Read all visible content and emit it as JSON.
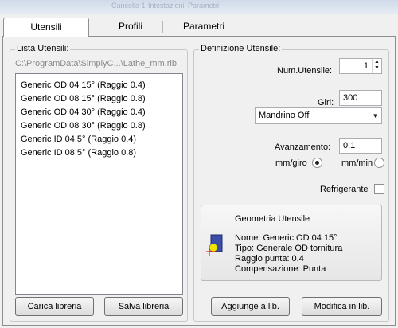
{
  "background_windows": [
    "Cancella 1",
    "Intestazioni",
    "Parametri"
  ],
  "tabs": [
    {
      "label": "Utensili",
      "selected": true
    },
    {
      "label": "Profili",
      "selected": false
    },
    {
      "label": "Parametri",
      "selected": false
    }
  ],
  "left": {
    "group_title": "Lista Utensili:",
    "path": "C:\\ProgramData\\SimplyC...\\Lathe_mm.rlb",
    "tools": [
      "Generic OD 04 15° (Raggio 0.4)",
      "Generic OD 08 15° (Raggio 0.8)",
      "Generic OD 04 30° (Raggio 0.4)",
      "Generic OD 08 30° (Raggio 0.8)",
      "Generic ID 04 5° (Raggio 0.4)",
      "Generic ID 08 5° (Raggio 0.8)"
    ],
    "load_button": "Carica libreria",
    "save_button": "Salva libreria"
  },
  "right": {
    "group_title": "Definizione Utensile:",
    "num_label": "Num.Utensile:",
    "num_value": "1",
    "giri_label": "Giri:",
    "giri_value": "300",
    "spindle_value": "Mandrino Off",
    "feed_label": "Avanzamento:",
    "feed_value": "0.1",
    "mm_giro_label": "mm/giro",
    "mm_min_label": "mm/min",
    "feed_mode": "mm/giro",
    "coolant_label": "Refrigerante",
    "coolant_checked": false,
    "geometry": {
      "title": "Geometria Utensile",
      "name": "Nome: Generic OD 04 15°",
      "type": "Tipo: Generale OD tornitura",
      "radius": "Raggio punta: 0.4",
      "compensation": "Compensazione: Punta"
    },
    "add_button": "Aggiunge a lib.",
    "modify_button": "Modifica in lib."
  },
  "colors": {
    "insert_fill": "#3b4fa8",
    "tip_circle": "#f2e600",
    "marker": "#e00000"
  }
}
